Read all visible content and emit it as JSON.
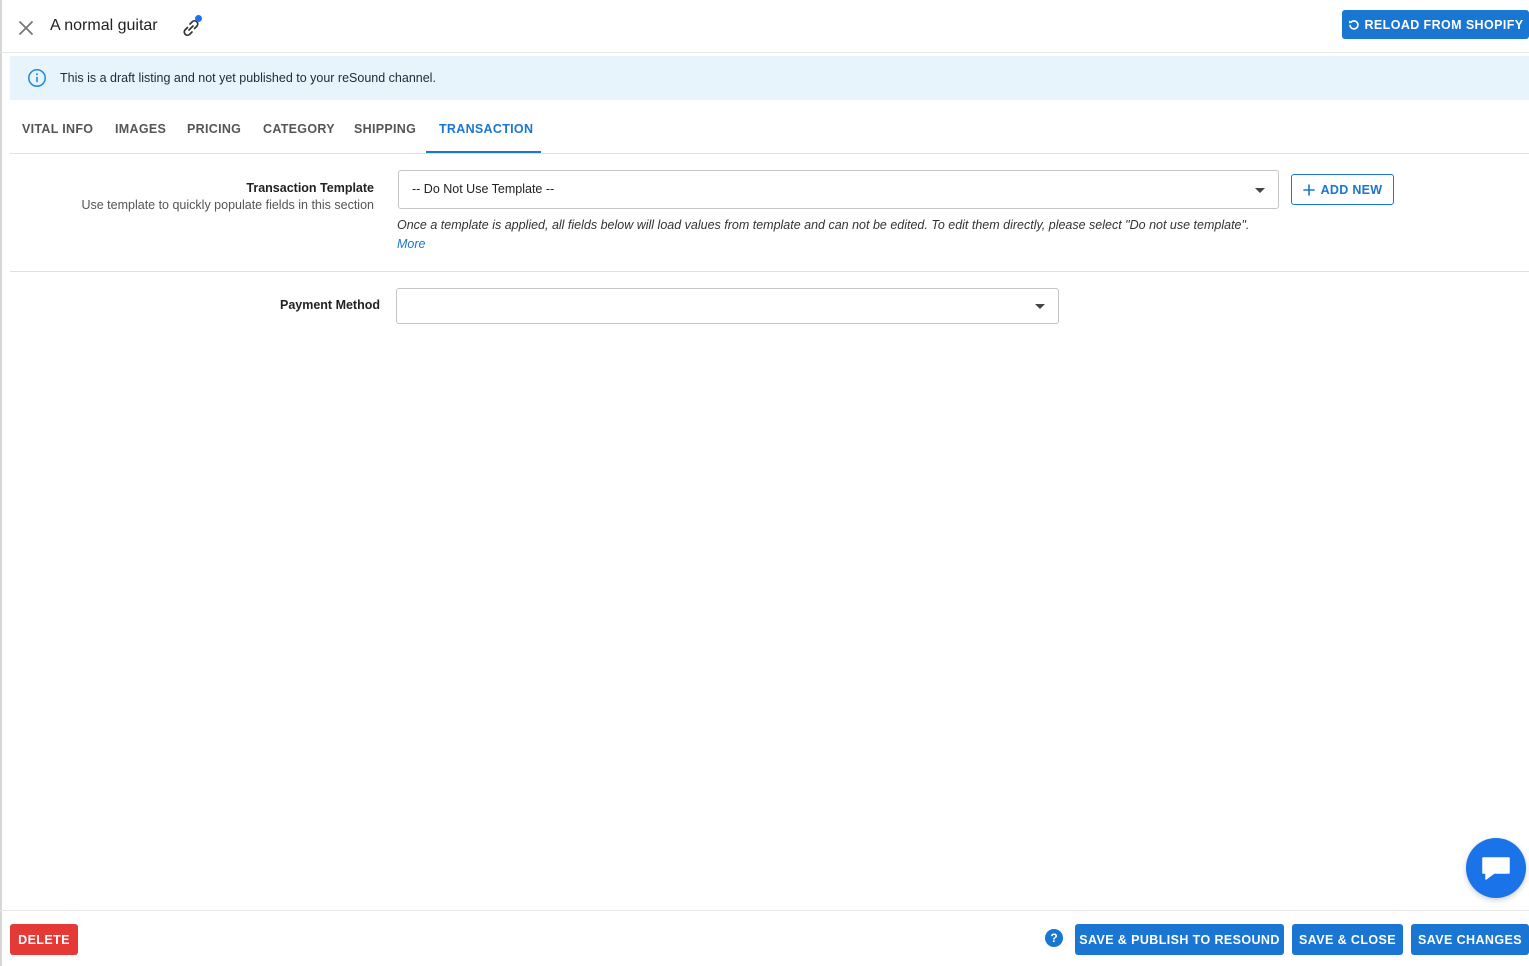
{
  "header": {
    "title": "A normal guitar",
    "reload_label": "RELOAD FROM SHOPIFY",
    "icons": {
      "close": "close-icon",
      "link": "link-icon",
      "reload": "reload-icon"
    }
  },
  "banner": {
    "text": "This is a draft listing and not yet published to your reSound channel.",
    "icon": "info-icon"
  },
  "tabs": [
    {
      "label": "VITAL INFO"
    },
    {
      "label": "IMAGES"
    },
    {
      "label": "PRICING"
    },
    {
      "label": "CATEGORY"
    },
    {
      "label": "SHIPPING"
    },
    {
      "label": "TRANSACTION",
      "active": true
    }
  ],
  "transaction_template": {
    "label": "Transaction Template",
    "sublabel": "Use template to quickly populate fields in this section",
    "selected": "-- Do Not Use Template --",
    "add_new_label": "ADD NEW",
    "help_text": "Once a template is applied, all fields below will load values from template and can not be edited. To edit them directly, please select \"Do not use template\".",
    "more_link": "More"
  },
  "payment_method": {
    "label": "Payment Method",
    "selected": ""
  },
  "footer": {
    "delete_label": "DELETE",
    "publish_label": "SAVE & PUBLISH TO RESOUND",
    "save_close_label": "SAVE & CLOSE",
    "save_changes_label": "SAVE CHANGES",
    "help_glyph": "?"
  },
  "colors": {
    "primary": "#1976d2",
    "danger": "#e53935",
    "banner_bg": "#e8f4fb",
    "chat": "#1a73e8"
  }
}
